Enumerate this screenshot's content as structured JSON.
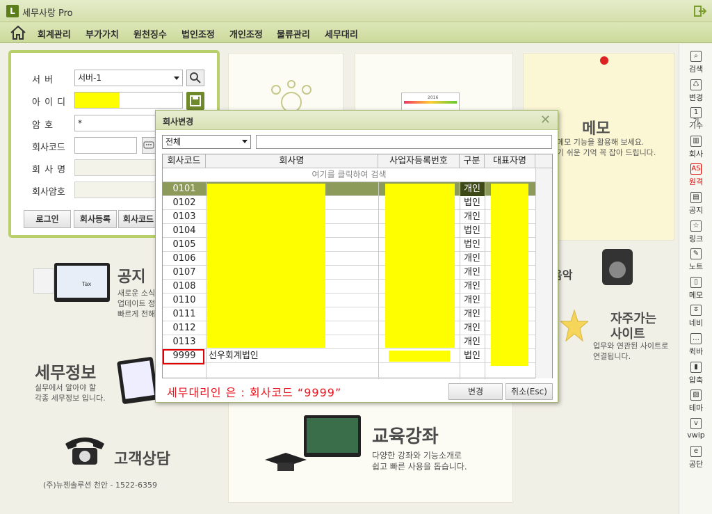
{
  "app": {
    "logo_letter": "L",
    "title": "세무사랑 Pro"
  },
  "menu": {
    "items": [
      "회계관리",
      "부가가치",
      "원천징수",
      "법인조정",
      "개인조정",
      "물류관리",
      "세무대리"
    ]
  },
  "sidebar": {
    "items": [
      {
        "label": "검색",
        "glyph": "⌕"
      },
      {
        "label": "변경",
        "glyph": "♺"
      },
      {
        "label": "기수",
        "glyph": "1기"
      },
      {
        "label": "회사",
        "glyph": "▥"
      },
      {
        "label": "원격",
        "glyph": "AS"
      },
      {
        "label": "공지",
        "glyph": "▤"
      },
      {
        "label": "링크",
        "glyph": "☆"
      },
      {
        "label": "노트",
        "glyph": "✎"
      },
      {
        "label": "메모",
        "glyph": "▯"
      },
      {
        "label": "네비",
        "glyph": "ㅎ"
      },
      {
        "label": "퀵바",
        "glyph": "…"
      },
      {
        "label": "압축",
        "glyph": "▮"
      },
      {
        "label": "테마",
        "glyph": "▨"
      },
      {
        "label": "vwip",
        "glyph": "v"
      },
      {
        "label": "공단",
        "glyph": "e"
      }
    ],
    "active_index": 4
  },
  "login": {
    "labels": {
      "server": "서    버",
      "id": "아 이 디",
      "password": "암    호",
      "company_code": "회사코드",
      "company_name": "회 사 명",
      "company_password": "회사암호"
    },
    "server_value": "서버-1",
    "password_value": "*",
    "buttons": {
      "login": "로그인",
      "register": "회사등록",
      "code": "회사코드"
    }
  },
  "tiles": {
    "notice_title": "공지",
    "notice_text": [
      "새로운 소식",
      "업데이트 정",
      "빠르게 전해"
    ],
    "tax_info_title": "세무정보",
    "tax_info_text": [
      "실무에서 알아야 할",
      "각종 세무정보 입니다."
    ],
    "customer_title": "고객상담",
    "customer_footer": "(주)뉴젠솔루션 천안 - 1522-6359",
    "edu_title": "교육강좌",
    "edu_text": [
      "다양한 강좌와 기능소개로",
      "쉽고 빠른 사용을 돕습니다."
    ],
    "memo_title": "메모",
    "memo_text": [
      "메모 기능을 활용해 보세요.",
      "기 쉬운 기억 꼭 잡아 드립니다."
    ],
    "music_title": "음악",
    "fav_title_1": "자주가는",
    "fav_title_2": "사이트",
    "fav_text": [
      "업무와 연관된 사이트로",
      "연결됩니다."
    ],
    "tax_label": "Tax",
    "calendar_year": "2016"
  },
  "dialog": {
    "title": "회사변경",
    "filter_value": "전체",
    "columns": [
      "회사코드",
      "회사명",
      "사업자등록번호",
      "구분",
      "대표자명"
    ],
    "search_hint": "여기를 클릭하여 검색",
    "rows": [
      {
        "code": "0101",
        "name": "",
        "type": "개인"
      },
      {
        "code": "0102",
        "name": "",
        "type": "법인"
      },
      {
        "code": "0103",
        "name": "",
        "type": "개인"
      },
      {
        "code": "0104",
        "name": "",
        "type": "법인"
      },
      {
        "code": "0105",
        "name": "",
        "type": "법인"
      },
      {
        "code": "0106",
        "name": "",
        "type": "개인"
      },
      {
        "code": "0107",
        "name": "",
        "type": "개인"
      },
      {
        "code": "0108",
        "name": "",
        "type": "개인"
      },
      {
        "code": "0110",
        "name": "",
        "type": "개인"
      },
      {
        "code": "0111",
        "name": "",
        "type": "개인"
      },
      {
        "code": "0112",
        "name": "",
        "type": "개인"
      },
      {
        "code": "0113",
        "name": "",
        "type": "개인"
      },
      {
        "code": "9999",
        "name": "선우회계법인",
        "type": "법인"
      }
    ],
    "selected_row": 0,
    "note": "세무대리인 은 : 회사코드 “9999”",
    "change_button": "변경",
    "cancel_button": "취소(Esc)"
  },
  "colors": {
    "accent": "#b9cf6c",
    "redaction": "#fefe00",
    "highlight_red": "#e00000",
    "selected_row": "#8c9a5a"
  }
}
